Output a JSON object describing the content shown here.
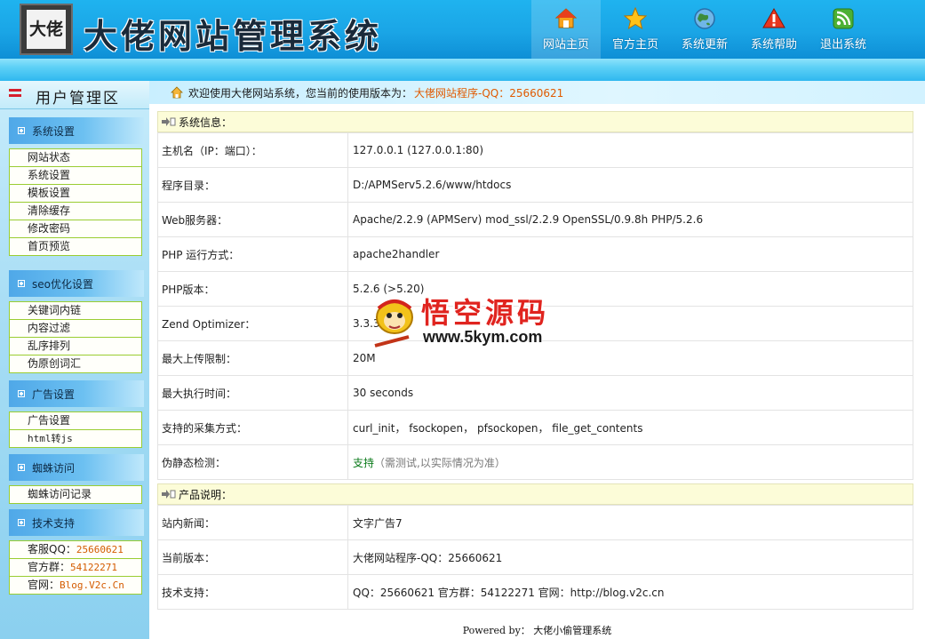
{
  "header": {
    "logo_text": "大佬",
    "title": "大佬网站管理系统",
    "nav": [
      {
        "label": "网站主页",
        "icon": "home-icon"
      },
      {
        "label": "官方主页",
        "icon": "star-icon"
      },
      {
        "label": "系统更新",
        "icon": "globe-icon"
      },
      {
        "label": "系统帮助",
        "icon": "warning-icon"
      },
      {
        "label": "退出系统",
        "icon": "rss-icon"
      }
    ]
  },
  "sidebar": {
    "title": "用户管理区",
    "groups": [
      {
        "title": "系统设置",
        "items": [
          "网站状态",
          "系统设置",
          "模板设置",
          "清除缓存",
          "修改密码",
          "首页预览"
        ]
      },
      {
        "title": "seo优化设置",
        "items": [
          "关键词内链",
          "内容过滤",
          "乱序排列",
          "伪原创词汇"
        ]
      },
      {
        "title": "广告设置",
        "items": [
          "广告设置",
          "html转js"
        ]
      },
      {
        "title": "蜘蛛访问",
        "items": [
          "蜘蛛访问记录"
        ]
      },
      {
        "title": "技术支持",
        "items": []
      }
    ],
    "support": [
      {
        "label": "客服QQ：",
        "value": "25660621"
      },
      {
        "label": "官方群：",
        "value": "54122271"
      },
      {
        "label": "官网：",
        "value": "Blog.V2c.Cn"
      }
    ]
  },
  "welcome": {
    "text": "欢迎使用大佬网站系统，您当前的使用版本为：",
    "version": "大佬网站程序-QQ：25660621"
  },
  "system_info": {
    "title": "系统信息：",
    "rows": [
      {
        "key": "主机名（IP：端口）：",
        "value": "127.0.0.1  (127.0.0.1:80)"
      },
      {
        "key": "程序目录：",
        "value": "D:/APMServ5.2.6/www/htdocs"
      },
      {
        "key": "Web服务器：",
        "value": "Apache/2.2.9 (APMServ) mod_ssl/2.2.9 OpenSSL/0.9.8h PHP/5.2.6"
      },
      {
        "key": "PHP 运行方式：",
        "value": "apache2handler"
      },
      {
        "key": "PHP版本：",
        "value": "5.2.6  (>5.20)"
      },
      {
        "key": "Zend Optimizer：",
        "value": "3.3.3"
      },
      {
        "key": "最大上传限制：",
        "value": "20M"
      },
      {
        "key": "最大执行时间：",
        "value": "30 seconds"
      },
      {
        "key": "支持的采集方式：",
        "value": "curl_init， fsockopen， pfsockopen， file_get_contents"
      }
    ],
    "rewrite": {
      "key": "伪静态检测：",
      "status": "支持",
      "note": "（需测试,以实际情况为准）"
    }
  },
  "product_info": {
    "title": "产品说明：",
    "rows": [
      {
        "key": "站内新闻：",
        "value": "文字广告7"
      },
      {
        "key": "当前版本：",
        "value": "大佬网站程序-QQ：25660621"
      },
      {
        "key": "技术支持：",
        "value": "QQ：25660621    官方群：54122271    官网：http://blog.v2c.cn"
      }
    ]
  },
  "footer": {
    "text": "Powered by：  大佬小偷管理系统"
  },
  "watermark": {
    "brand": "悟空源码",
    "url": "www.5kym.com"
  },
  "colors": {
    "accent_blue": "#1aa5e6",
    "version_orange": "#e05a00",
    "ok_green": "#0a7a1a",
    "table_header_bg": "#fcfcd8"
  }
}
